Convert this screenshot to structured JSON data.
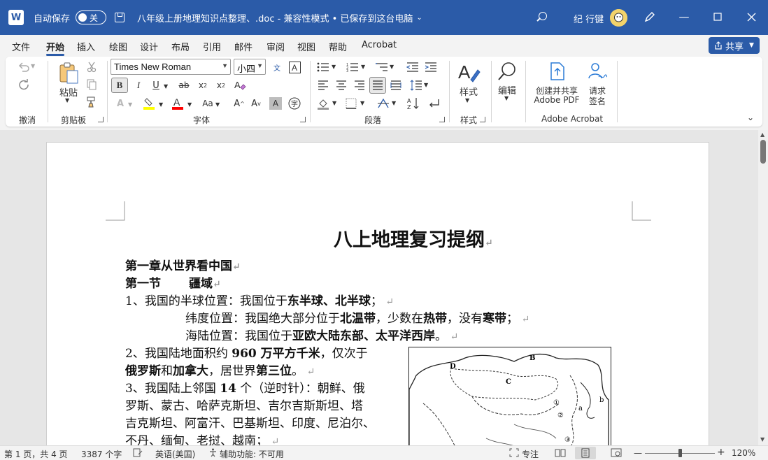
{
  "titlebar": {
    "autosave_label": "自动保存",
    "autosave_state": "关",
    "document_title": "八年级上册地理知识点整理、.doc  -  兼容性模式 • 已保存到这台电脑",
    "user_name": "纪 行键",
    "avatar_text": "Ã"
  },
  "menu": {
    "tabs": [
      "文件",
      "开始",
      "插入",
      "绘图",
      "设计",
      "布局",
      "引用",
      "邮件",
      "审阅",
      "视图",
      "帮助",
      "Acrobat"
    ],
    "active_tab": "开始",
    "share_label": "共享"
  },
  "ribbon": {
    "groups": {
      "undo": "撤消",
      "clipboard": "剪贴板",
      "font": "字体",
      "paragraph": "段落",
      "styles": "样式",
      "acrobat": "Adobe Acrobat"
    },
    "paste_label": "粘贴",
    "font_name": "Times New Roman",
    "font_size": "小四",
    "styles_label": "样式",
    "edit_label": "编辑",
    "create_pdf_line1": "创建并共享",
    "create_pdf_line2": "Adobe PDF",
    "request_sign_line1": "请求",
    "request_sign_line2": "签名"
  },
  "document": {
    "heading": "八上地理复习提纲",
    "chapter": "第一章从世界看中国",
    "section_a": "第一节",
    "section_b": "疆域",
    "p1_prefix": "1、我国的半球位置：我国位于",
    "p1_bold": "东半球、北半球",
    "p1_suffix": "；",
    "p2_prefix": "纬度位置：我国绝大部分位于",
    "p2_bold1": "北温带",
    "p2_mid1": "，少数在",
    "p2_bold2": "热带",
    "p2_mid2": "，没有",
    "p2_bold3": "寒带",
    "p2_suffix": "；",
    "p3_prefix": "海陆位置：我国位于",
    "p3_bold": "亚欧大陆东部、太平洋西岸",
    "p3_suffix": "。",
    "p4_prefix": "2、我国陆地面积约 ",
    "p4_bold": "960 万平方千米",
    "p4_suffix": "，仅次于",
    "p5_bold1": "俄罗斯",
    "p5_mid": "和",
    "p5_bold2": "加拿大",
    "p5_mid2": "，居世界",
    "p5_bold3": "第三位",
    "p5_suffix": "。",
    "p6_prefix": "3、我国陆上邻国 ",
    "p6_bold": "14",
    "p6_suffix": " 个（逆时针）：朝鲜、俄",
    "p7": "罗斯、蒙古、哈萨克斯坦、吉尔吉斯斯坦、塔",
    "p8": "吉克斯坦、阿富汗、巴基斯坦、印度、尼泊尔、",
    "p9": "不丹、缅甸、老挝、越南；",
    "map_labels": [
      "D",
      "B",
      "C",
      "a",
      "b",
      "①",
      "②",
      "③"
    ]
  },
  "status": {
    "page": "第 1 页，共 4 页",
    "words": "3387 个字",
    "language": "英语(美国)",
    "accessibility": "辅助功能: 不可用",
    "focus": "专注",
    "zoom": "120%"
  },
  "colors": {
    "brand_blue": "#2b5ba8",
    "highlight_yellow": "#ffff00",
    "font_red": "#ff0000"
  }
}
